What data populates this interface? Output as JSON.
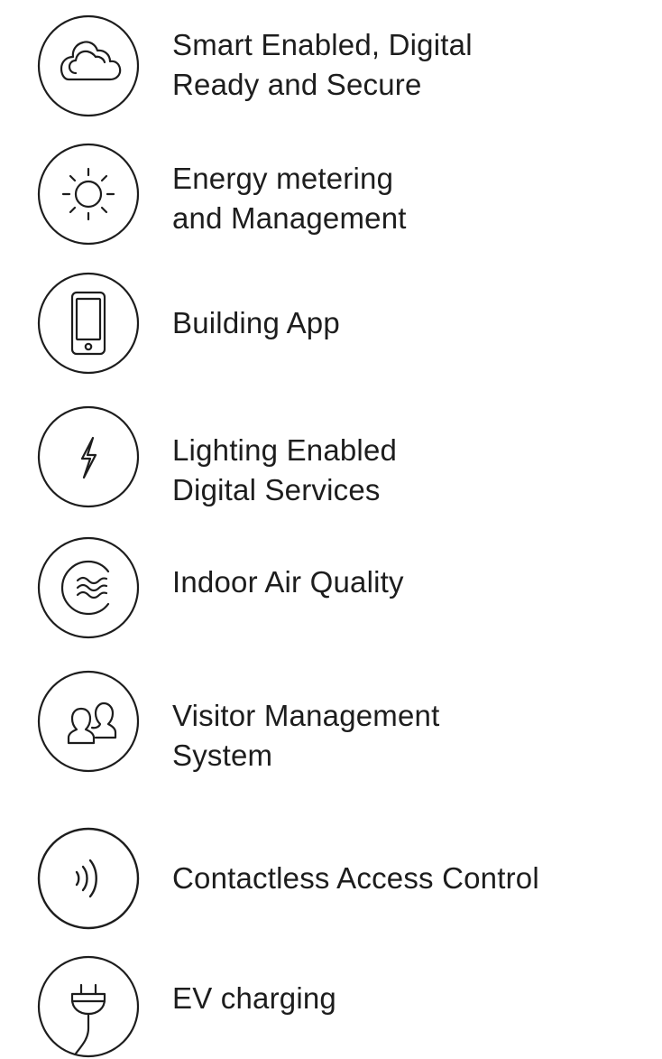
{
  "features": [
    {
      "label": "Smart Enabled, Digital\nReady and Secure",
      "icon": "cloud-icon"
    },
    {
      "label": "Energy metering\nand Management",
      "icon": "sun-icon"
    },
    {
      "label": "Building App",
      "icon": "smartphone-icon"
    },
    {
      "label": "Lighting Enabled\nDigital Services",
      "icon": "lightning-bolt-icon"
    },
    {
      "label": "Indoor Air Quality",
      "icon": "air-waves-icon"
    },
    {
      "label": "Visitor Management\nSystem",
      "icon": "people-icon"
    },
    {
      "label": "Contactless Access Control",
      "icon": "contactless-icon"
    },
    {
      "label": "EV charging",
      "icon": "ev-plug-icon"
    }
  ],
  "colors": {
    "text": "#1d1d1d",
    "stroke": "#1d1d1d",
    "background": "#ffffff"
  }
}
